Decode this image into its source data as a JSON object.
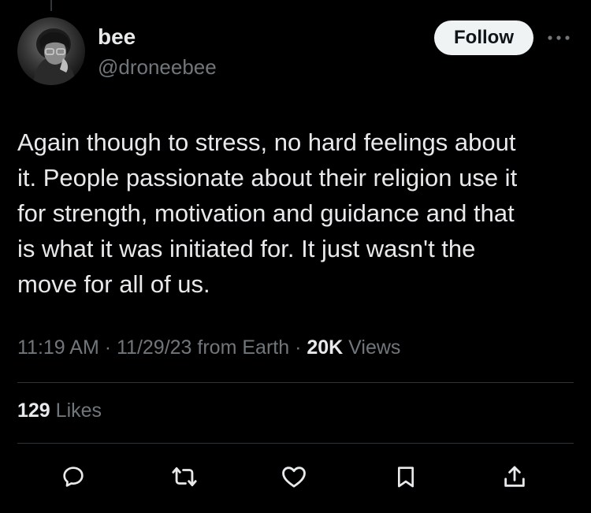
{
  "author": {
    "display_name": "bee",
    "handle": "@droneebee",
    "avatar": "profile-photo"
  },
  "header": {
    "follow_label": "Follow",
    "more_icon": "more-horizontal-icon"
  },
  "tweet": {
    "lines": [
      "Again though to stress, no hard feelings about",
      "it. People passionate about their religion use it",
      "for strength, motivation and guidance and that",
      "is what it was initiated for. It just wasn't the",
      "move for all of us."
    ]
  },
  "meta": {
    "time": "11:19 AM",
    "sep1": " · ",
    "date": "11/29/23",
    "source": " from Earth",
    "sep2": " · ",
    "views_count": "20K",
    "views_label": " Views"
  },
  "stats": {
    "likes_count": "129",
    "likes_label": " Likes"
  },
  "actions": [
    {
      "icon": "reply-icon"
    },
    {
      "icon": "retweet-icon"
    },
    {
      "icon": "like-icon"
    },
    {
      "icon": "bookmark-icon"
    },
    {
      "icon": "share-icon"
    }
  ],
  "colors": {
    "background": "#000000",
    "text": "#e7e9ea",
    "secondary": "#71767b",
    "divider": "#2f3336",
    "button_bg": "#eff3f4"
  }
}
